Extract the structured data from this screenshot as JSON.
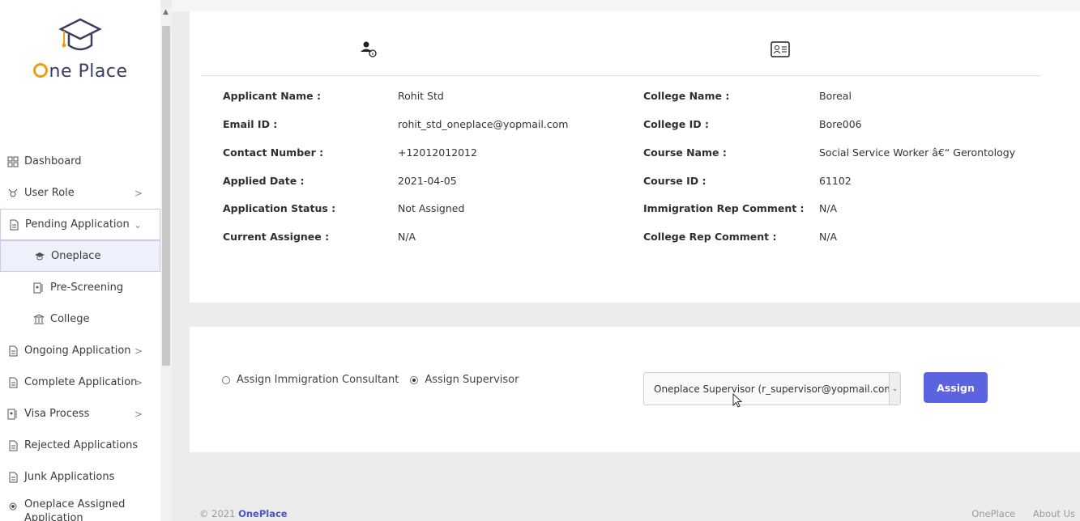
{
  "brand": {
    "name": "One Place",
    "footer_year": "© 2021",
    "footer_brand": "OnePlace"
  },
  "sidebar": {
    "items": [
      {
        "label": "Dashboard",
        "icon": "dashboard-icon",
        "chevron": ""
      },
      {
        "label": "User Role",
        "icon": "user-role-icon",
        "chevron": ">"
      },
      {
        "label": "Pending Application",
        "icon": "document-icon",
        "chevron": "⌄"
      },
      {
        "label": "Oneplace",
        "icon": "graduation-cap-icon",
        "chevron": ""
      },
      {
        "label": "Pre-Screening",
        "icon": "pre-screening-icon",
        "chevron": ""
      },
      {
        "label": "College",
        "icon": "institution-icon",
        "chevron": ""
      },
      {
        "label": "Ongoing Application",
        "icon": "document-icon",
        "chevron": ">"
      },
      {
        "label": "Complete Application",
        "icon": "document-icon",
        "chevron": ">"
      },
      {
        "label": "Visa Process",
        "icon": "visa-icon",
        "chevron": ">"
      },
      {
        "label": "Rejected Applications",
        "icon": "document-icon",
        "chevron": ""
      },
      {
        "label": "Junk Applications",
        "icon": "document-icon",
        "chevron": ""
      },
      {
        "label": "Oneplace Assigned Application",
        "icon": "dot-icon",
        "chevron": ""
      }
    ]
  },
  "applicant": {
    "name_label": "Applicant Name :",
    "name": "Rohit Std",
    "email_label": "Email ID :",
    "email": "rohit_std_oneplace@yopmail.com",
    "contact_label": "Contact Number :",
    "contact": "+12012012012",
    "applied_label": "Applied Date :",
    "applied": "2021-04-05",
    "status_label": "Application Status :",
    "status": "Not Assigned",
    "assignee_label": "Current Assignee :",
    "assignee": "N/A"
  },
  "college": {
    "name_label": "College Name :",
    "name": "Boreal",
    "id_label": "College ID :",
    "id": "Bore006",
    "course_label": "Course Name :",
    "course": "Social Service Worker â€“ Gerontology",
    "course_id_label": "Course ID :",
    "course_id": "61102",
    "imm_comment_label": "Immigration Rep Comment :",
    "imm_comment": "N/A",
    "college_comment_label": "College Rep Comment :",
    "college_comment": "N/A"
  },
  "assign": {
    "option1": "Assign Immigration Consultant",
    "option2": "Assign Supervisor",
    "selected_option": "Assign Supervisor",
    "select_value": "Oneplace Supervisor (r_supervisor@yopmail.com",
    "button": "Assign"
  },
  "footer": {
    "links": [
      "OnePlace",
      "About Us"
    ]
  },
  "colors": {
    "accent": "#5b63e0",
    "logo_ring": "#f39c12"
  }
}
